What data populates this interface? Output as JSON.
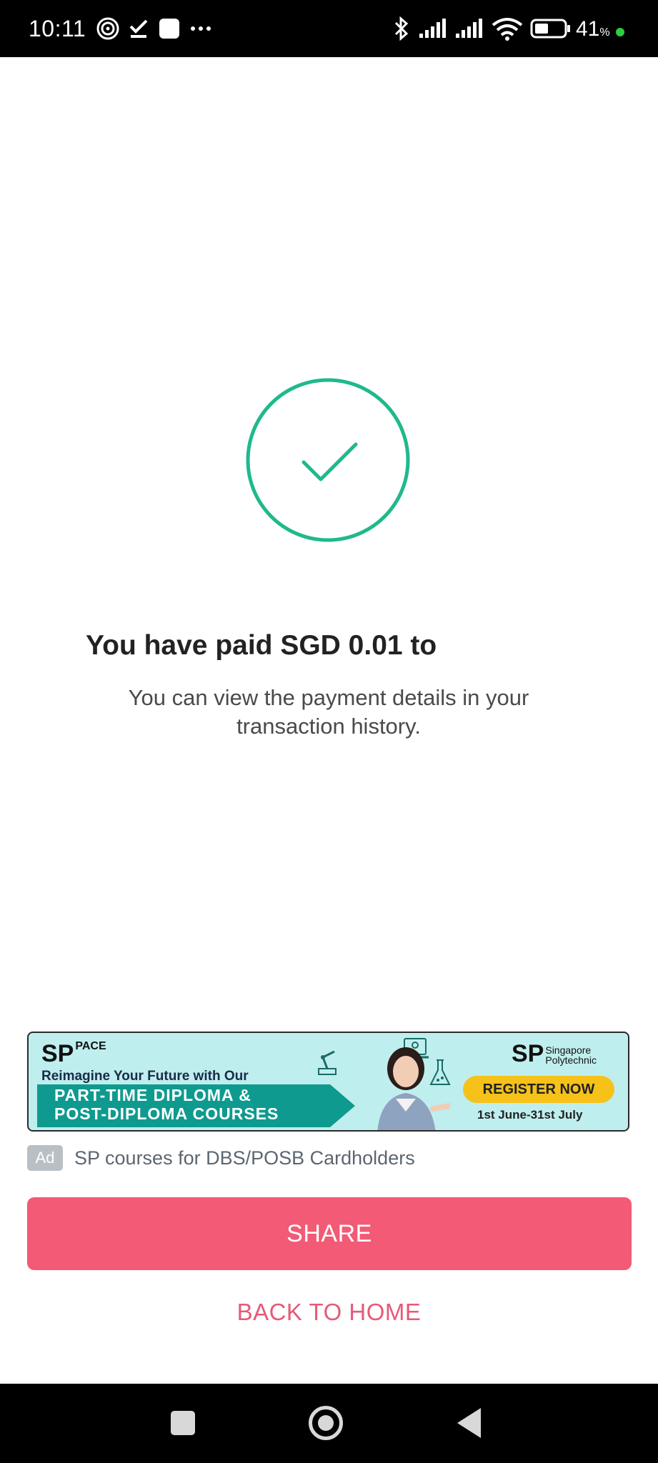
{
  "status_bar": {
    "time": "10:11",
    "battery_percent": "41",
    "battery_unit": "%",
    "icons": [
      "nfc-icon",
      "download-done-icon",
      "app-icon",
      "more-icon",
      "bluetooth-icon",
      "signal-icon",
      "signal-icon",
      "wifi-icon",
      "battery-icon"
    ]
  },
  "result": {
    "status_icon": "check-circle-icon",
    "accent_color": "#1fb98c",
    "headline": "You have paid SGD 0.01 to",
    "subtext": "You can view the payment details in your transaction history."
  },
  "ad": {
    "banner": {
      "brand_left": "SP",
      "brand_left_sub": "PACE",
      "tagline": "Reimagine Your Future with Our",
      "course_line_1": "PART-TIME DIPLOMA &",
      "course_line_2": "POST-DIPLOMA COURSES",
      "brand_right": "SP",
      "brand_right_sub_1": "Singapore",
      "brand_right_sub_2": "Polytechnic",
      "cta": "REGISTER NOW",
      "dates": "1st June-31st July"
    },
    "badge": "Ad",
    "caption": "SP courses for DBS/POSB Cardholders"
  },
  "actions": {
    "share_label": "SHARE",
    "home_label": "BACK TO HOME",
    "share_color": "#f25a75"
  },
  "nav_bar": {
    "icons": [
      "recent-apps-icon",
      "home-icon",
      "back-icon"
    ]
  }
}
